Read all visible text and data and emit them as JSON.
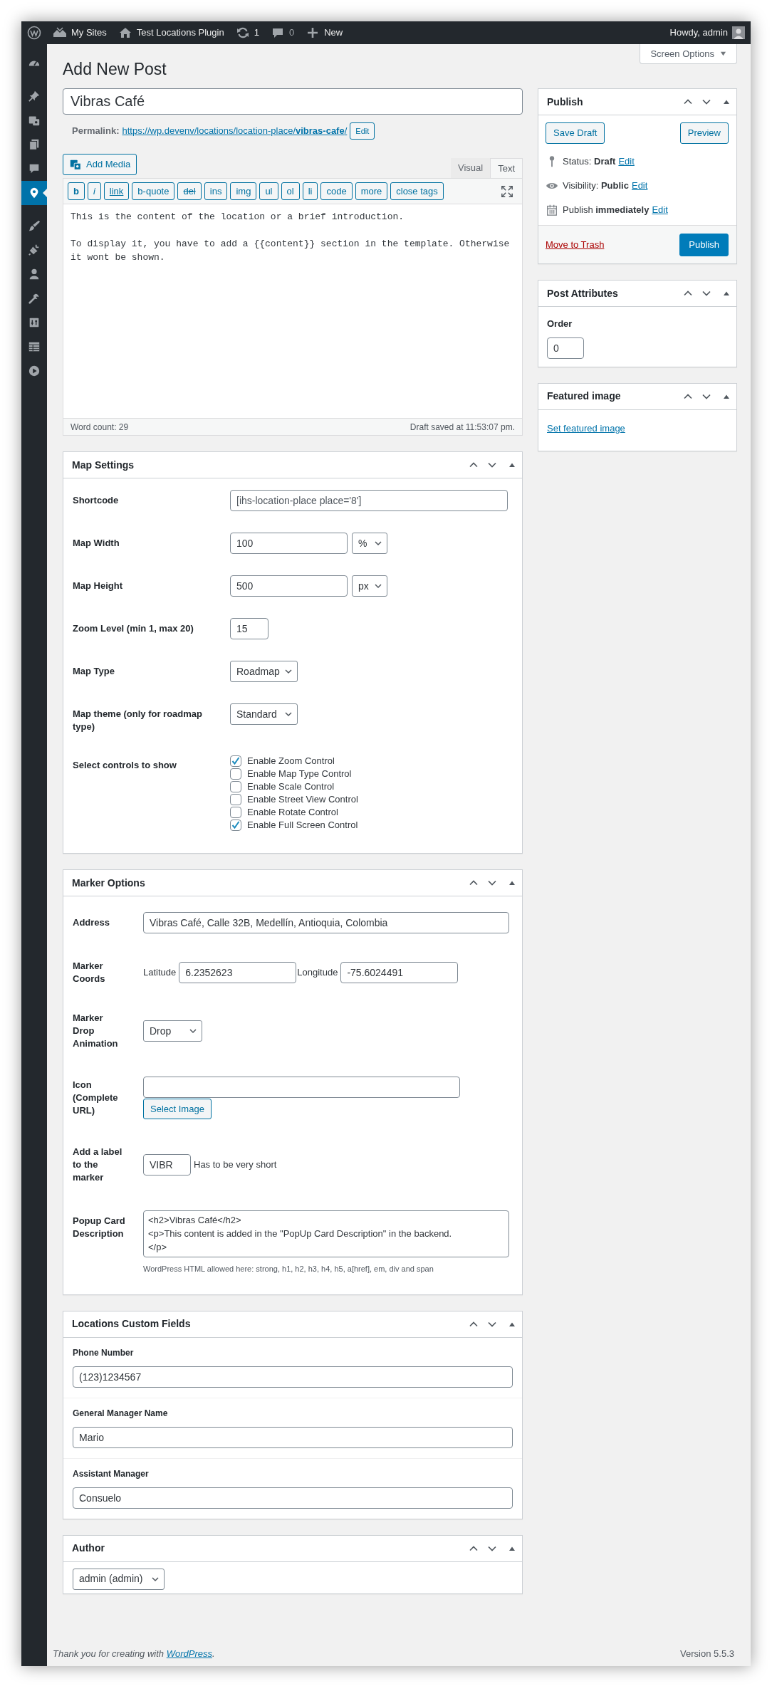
{
  "admin_bar": {
    "items": [
      {
        "kind": "wp"
      },
      {
        "kind": "sites",
        "label": "My Sites"
      },
      {
        "kind": "home",
        "label": "Test Locations Plugin"
      },
      {
        "kind": "updates",
        "label": "1"
      },
      {
        "kind": "comments",
        "label": "0"
      },
      {
        "kind": "new",
        "label": "New"
      }
    ],
    "greeting": "Howdy, admin"
  },
  "menu_groups": [
    [
      {
        "kind": "dashboard",
        "selected": false
      }
    ],
    [
      {
        "kind": "pin",
        "selected": false
      },
      {
        "kind": "media",
        "selected": false
      },
      {
        "kind": "pages",
        "selected": false
      },
      {
        "kind": "comments",
        "selected": false
      },
      {
        "kind": "location",
        "selected": true
      }
    ],
    [
      {
        "kind": "brush",
        "selected": false
      },
      {
        "kind": "plugin",
        "selected": false
      },
      {
        "kind": "user",
        "selected": false
      },
      {
        "kind": "wrench",
        "selected": false
      },
      {
        "kind": "settings",
        "selected": false
      },
      {
        "kind": "table",
        "selected": false
      },
      {
        "kind": "play",
        "selected": false
      }
    ]
  ],
  "screen_options": "Screen Options",
  "page_title": "Add New Post",
  "post_title": "Vibras Café",
  "permalink": {
    "label": "Permalink:",
    "url": "https://wp.devenv/locations/location-place/**vibras-cafe**/",
    "button": "Edit"
  },
  "add_media": "Add Media",
  "editor_tabs": [
    {
      "label": "Visual",
      "selected": false
    },
    {
      "label": "Text",
      "selected": true
    }
  ],
  "quicktags": [
    {
      "label": "b",
      "kind": "bold"
    },
    {
      "label": "i",
      "kind": "italic"
    },
    {
      "label": "link",
      "kind": "link"
    },
    {
      "label": "b-quote",
      "kind": "plain"
    },
    {
      "label": "del",
      "kind": "strike"
    },
    {
      "label": "ins",
      "kind": "plain"
    },
    {
      "label": "img",
      "kind": "plain"
    },
    {
      "label": "ul",
      "kind": "plain"
    },
    {
      "label": "ol",
      "kind": "plain"
    },
    {
      "label": "li",
      "kind": "plain"
    },
    {
      "label": "code",
      "kind": "plain"
    },
    {
      "label": "more",
      "kind": "plain"
    },
    {
      "label": "close tags",
      "kind": "plain"
    }
  ],
  "content": "This is the content of the location or a brief introduction.\n\nTo display it, you have to add a {{content}} section in the template. Otherwise it wont be shown.",
  "word_count": "Word count: 29",
  "draft_saved": "Draft saved at 11:53:07 pm.",
  "map_settings": {
    "title": "Map Settings",
    "rows": [
      {
        "kind": "readonly",
        "label": "Shortcode",
        "value": "[ihs-location-place place='8']"
      },
      {
        "kind": "number_unit",
        "label": "Map Width",
        "value": "100",
        "unit": "%"
      },
      {
        "kind": "number_unit",
        "label": "Map Height",
        "value": "500",
        "unit": "px"
      },
      {
        "kind": "number",
        "label": "Zoom Level (min 1, max 20)",
        "value": "15"
      },
      {
        "kind": "select",
        "label": "Map Type",
        "value": "Roadmap"
      },
      {
        "kind": "select",
        "label": "Map theme (only for roadmap type)",
        "value": "Standard"
      },
      {
        "kind": "checkboxes",
        "label": "Select controls to show",
        "options": [
          {
            "label": "Enable Zoom Control",
            "checked": true
          },
          {
            "label": "Enable Map Type Control",
            "checked": false
          },
          {
            "label": "Enable Scale Control",
            "checked": false
          },
          {
            "label": "Enable Street View Control",
            "checked": false
          },
          {
            "label": "Enable Rotate Control",
            "checked": false
          },
          {
            "label": "Enable Full Screen Control",
            "checked": true
          }
        ]
      }
    ]
  },
  "marker_options": {
    "title": "Marker Options",
    "rows": [
      {
        "kind": "text",
        "label": "Address",
        "value": "Vibras Café, Calle 32B, Medellín, Antioquia, Colombia"
      },
      {
        "kind": "coords",
        "label": "Marker Coords",
        "fields": [
          {
            "label": "Latitude",
            "value": "6.2352623"
          },
          {
            "label": "Longitude",
            "value": "-75.6024491"
          }
        ]
      },
      {
        "kind": "select",
        "label": "Marker Drop Animation",
        "value": "Drop"
      },
      {
        "kind": "url",
        "label": "Icon (Complete URL)",
        "button": "Select Image"
      },
      {
        "kind": "short",
        "label": "Add a label to the marker",
        "value": "VIBR",
        "hint": "Has to be very short"
      },
      {
        "kind": "textarea",
        "label": "Popup Card Description",
        "value": "<h2>Vibras Café</h2>\n<p>This content is added in the \"PopUp Card Description\" in the backend.\n</p>",
        "help": "WordPress HTML allowed here: strong, h1, h2, h3, h4, h5, a[href], em, div and span"
      }
    ]
  },
  "custom_fields": {
    "title": "Locations Custom Fields",
    "fields": [
      {
        "label": "Phone Number",
        "value": "(123)1234567"
      },
      {
        "label": "General Manager Name",
        "value": "Mario"
      },
      {
        "label": "Assistant Manager",
        "value": "Consuelo"
      }
    ]
  },
  "author": {
    "title": "Author",
    "value": "admin (admin)"
  },
  "publish": {
    "title": "Publish",
    "save_draft": "Save Draft",
    "preview": "Preview",
    "rows": [
      {
        "kind": "status",
        "text": "Status: **Draft**",
        "link": "Edit"
      },
      {
        "kind": "visibility",
        "text": "Visibility: **Public**",
        "link": "Edit"
      },
      {
        "kind": "schedule",
        "text": "Publish **immediately**",
        "link": "Edit"
      }
    ],
    "trash": "Move to Trash",
    "publish_button": "Publish"
  },
  "post_attributes": {
    "title": "Post Attributes",
    "order_label": "Order",
    "order": "0"
  },
  "featured_image": {
    "title": "Featured image",
    "link": "Set featured image"
  },
  "footer": {
    "text": "Thank you for creating with",
    "link": "WordPress",
    "end": ".",
    "version": "Version 5.5.3"
  }
}
